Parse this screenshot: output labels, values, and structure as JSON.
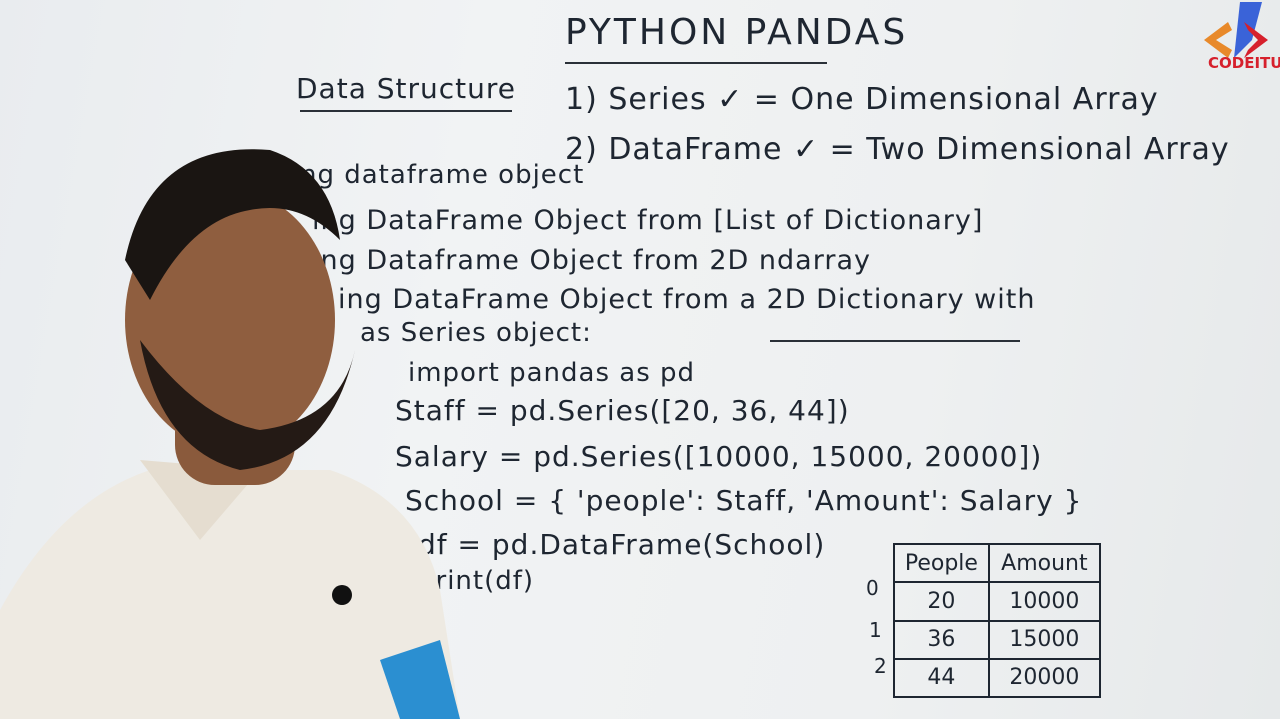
{
  "board": {
    "title": "PYTHON PANDAS",
    "data_structure_heading": "Data Structure",
    "series_line": "1) Series ✓ = One Dimensional Array",
    "dataframe_line": "2) DataFrame ✓ = Two Dimensional Array",
    "line1": "ng dataframe object",
    "line2": "ing DataFrame Object from [List of Dictionary]",
    "line3": "ing Dataframe Object from 2D ndarray",
    "line4": "ing DataFrame Object from a 2D Dictionary with",
    "line4b": "as Series object:",
    "code1": "import pandas as pd",
    "code2": "Staff = pd.Series([20, 36, 44])",
    "code3": "Salary = pd.Series([10000, 15000, 20000])",
    "code4": "School = { 'people': Staff, 'Amount': Salary }",
    "code5": "df = pd.DataFrame(School)",
    "code6": "print(df)"
  },
  "table": {
    "headers": [
      "People",
      "Amount"
    ],
    "index": [
      "0",
      "1",
      "2"
    ],
    "rows": [
      [
        "20",
        "10000"
      ],
      [
        "36",
        "15000"
      ],
      [
        "44",
        "20000"
      ]
    ]
  },
  "logo": {
    "text": "CODEITUP"
  },
  "colors": {
    "marker": "#1e2631",
    "logo_red": "#d6202c",
    "logo_blue": "#3a63d8",
    "shirt": "#eeeae2"
  }
}
